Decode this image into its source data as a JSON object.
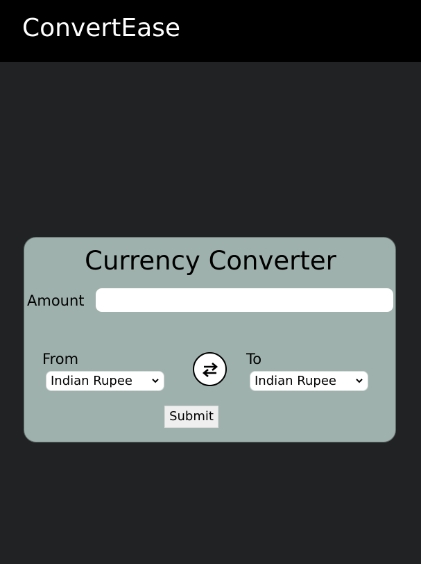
{
  "header": {
    "brand": "ConvertEase"
  },
  "converter": {
    "title": "Currency Converter",
    "amount_label": "Amount",
    "amount_value": "",
    "from_label": "From",
    "to_label": "To",
    "from_selected": "Indian Rupee",
    "to_selected": "Indian Rupee",
    "swap_icon": "swap-arrows-icon",
    "submit_label": "Submit"
  },
  "colors": {
    "background": "#212224",
    "topbar": "#000000",
    "card": "#9eb1ad"
  }
}
